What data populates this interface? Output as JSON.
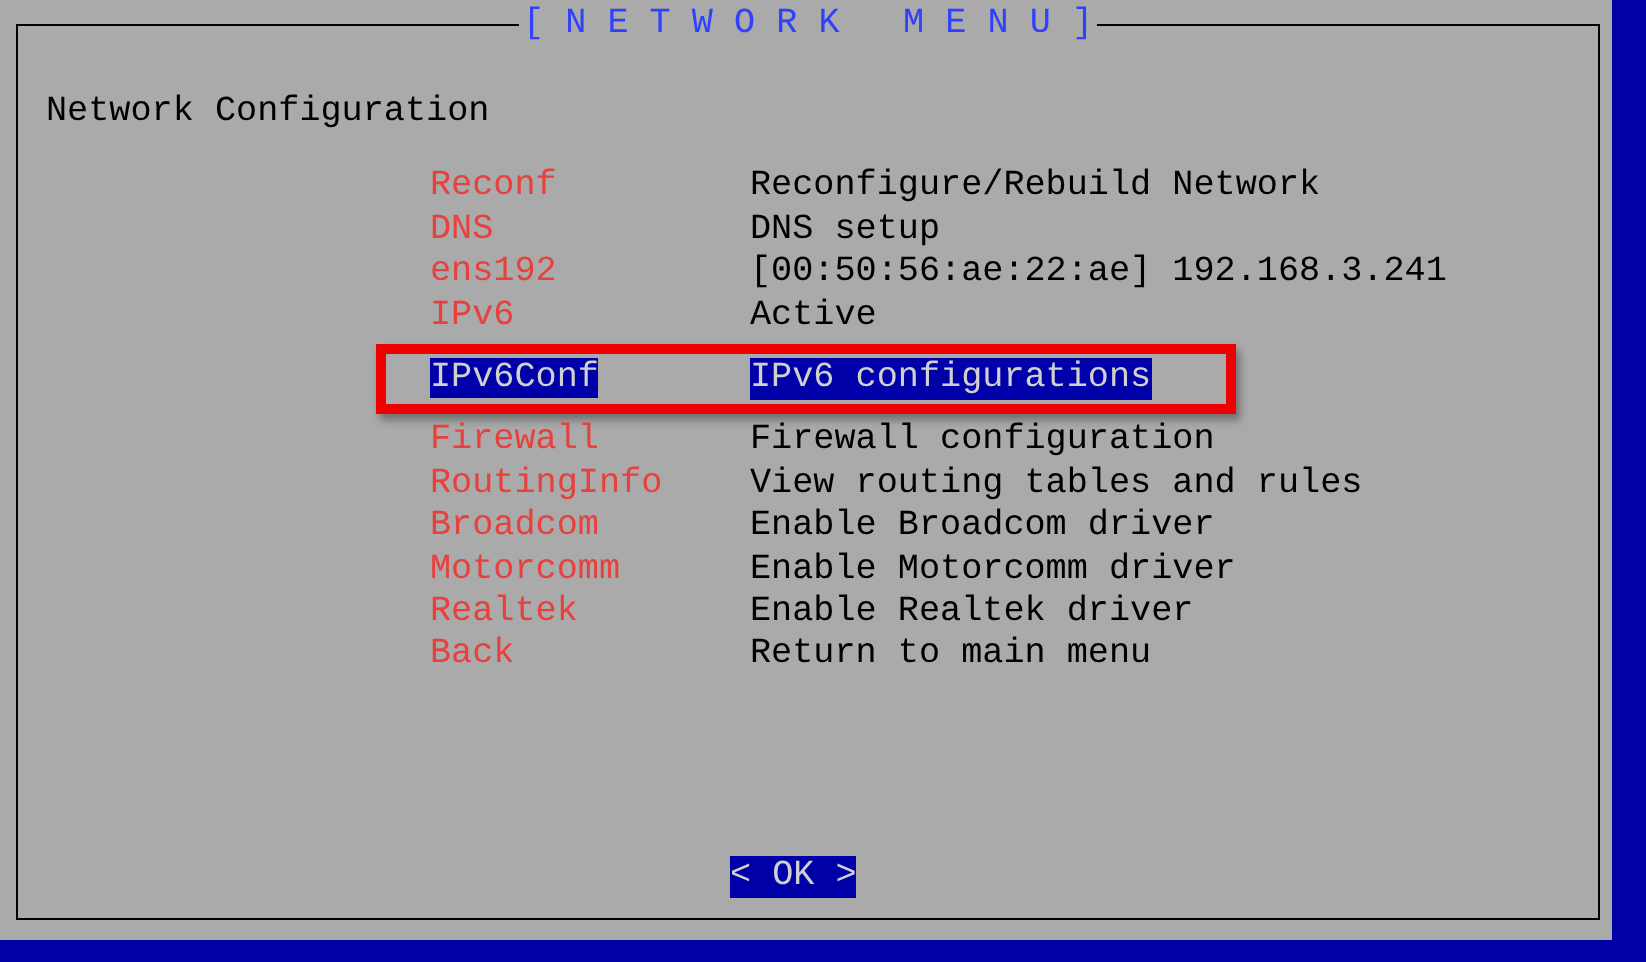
{
  "dialog": {
    "title": "[ N E T W O R K   M E N U ]",
    "prompt": "Network Configuration",
    "items": [
      {
        "tag": "Reconf",
        "description": "Reconfigure/Rebuild Network",
        "selected": false,
        "annotated": false
      },
      {
        "tag": "DNS",
        "description": "DNS setup",
        "selected": false,
        "annotated": false
      },
      {
        "tag": "ens192",
        "description": "[00:50:56:ae:22:ae] 192.168.3.241",
        "selected": false,
        "annotated": false
      },
      {
        "tag": "IPv6",
        "description": "Active",
        "selected": false,
        "annotated": false
      },
      {
        "tag": "IPv6Conf",
        "description": "IPv6 configurations",
        "selected": true,
        "annotated": true
      },
      {
        "tag": "Firewall",
        "description": "Firewall configuration",
        "selected": false,
        "annotated": false
      },
      {
        "tag": "RoutingInfo",
        "description": "View routing tables and rules",
        "selected": false,
        "annotated": false
      },
      {
        "tag": "Broadcom",
        "description": "Enable Broadcom driver",
        "selected": false,
        "annotated": false
      },
      {
        "tag": "Motorcomm",
        "description": "Enable Motorcomm driver",
        "selected": false,
        "annotated": false
      },
      {
        "tag": "Realtek",
        "description": "Enable Realtek driver",
        "selected": false,
        "annotated": false
      },
      {
        "tag": "Back",
        "description": "Return to main menu",
        "selected": false,
        "annotated": false
      }
    ],
    "buttons": [
      {
        "label": "< OK >",
        "selected": true
      }
    ]
  }
}
